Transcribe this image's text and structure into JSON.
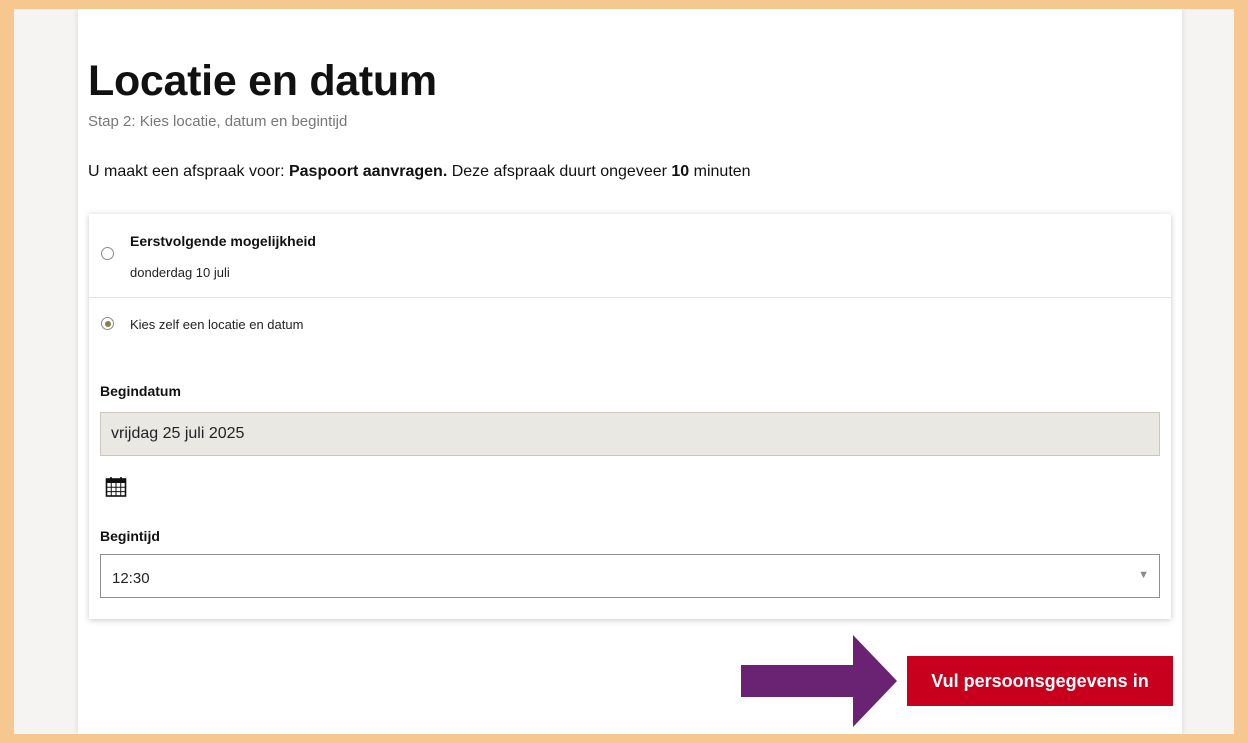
{
  "header": {
    "title": "Locatie en datum",
    "subtitle": "Stap 2: Kies locatie, datum en begintijd"
  },
  "intro": {
    "prefix": "U maakt een afspraak voor: ",
    "service": "Paspoort aanvragen.",
    "middle": " Deze afspraak duurt ongeveer ",
    "duration": "10",
    "suffix": " minuten"
  },
  "options": {
    "first_available": {
      "title": "Eerstvolgende mogelijkheid",
      "date": "donderdag 10 juli",
      "selected": false
    },
    "choose_own": {
      "label": "Kies zelf een locatie en datum",
      "selected": true
    }
  },
  "form": {
    "start_date_label": "Begindatum",
    "start_date_value": "vrijdag 25 juli 2025",
    "calendar_icon": "calendar-icon",
    "start_time_label": "Begintijd",
    "start_time_value": "12:30"
  },
  "actions": {
    "next_label": "Vul persoonsgegevens in"
  },
  "colors": {
    "frame": "#f6c890",
    "primary_button": "#c8001e",
    "annotation_arrow": "#6a2273"
  }
}
